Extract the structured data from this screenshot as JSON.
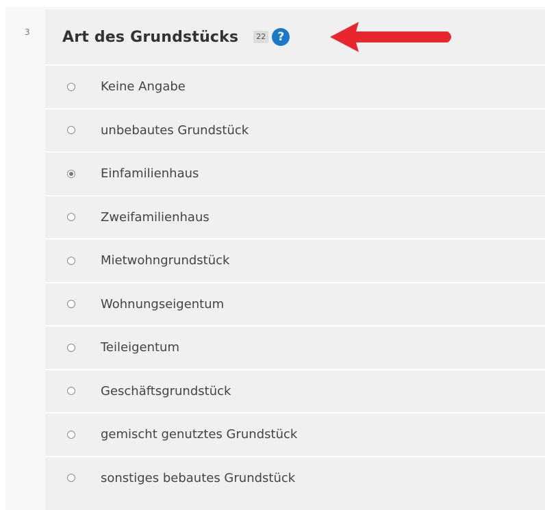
{
  "question": {
    "number": "3",
    "title": "Art des Grundstücks",
    "badge": "22",
    "help_icon": "question-circle-icon",
    "help_symbol": "?"
  },
  "options": [
    {
      "label": "Keine Angabe",
      "selected": false
    },
    {
      "label": "unbebautes Grundstück",
      "selected": false
    },
    {
      "label": "Einfamilienhaus",
      "selected": true
    },
    {
      "label": "Zweifamilienhaus",
      "selected": false
    },
    {
      "label": "Mietwohngrundstück",
      "selected": false
    },
    {
      "label": "Wohnungseigentum",
      "selected": false
    },
    {
      "label": "Teileigentum",
      "selected": false
    },
    {
      "label": "Geschäftsgrundstück",
      "selected": false
    },
    {
      "label": "gemischt genutztes Grundstück",
      "selected": false
    },
    {
      "label": "sonstiges bebautes Grundstück",
      "selected": false
    }
  ],
  "colors": {
    "help_icon": "#1a78c8",
    "annotation_arrow": "#e8262e",
    "panel_background": "#f0f0f0"
  }
}
